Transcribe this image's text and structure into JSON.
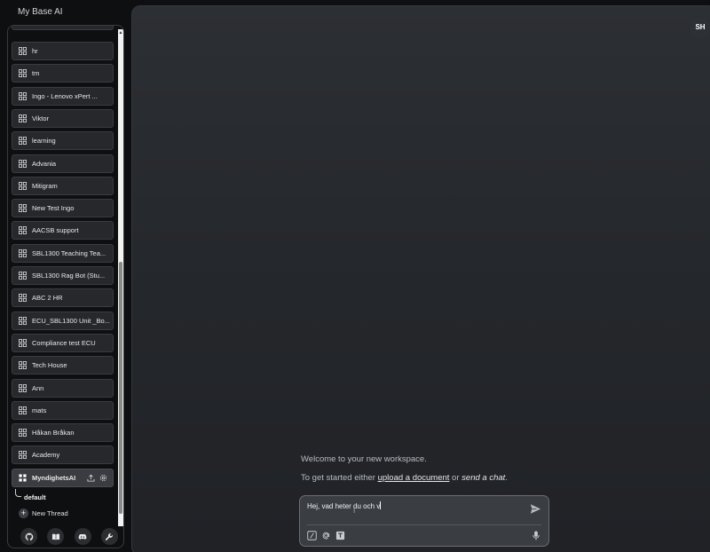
{
  "app": {
    "title": "My Base AI"
  },
  "sidebar": {
    "workspaces": [
      {
        "label": "hr"
      },
      {
        "label": "tm"
      },
      {
        "label": "Ingo - Lenovo xPert ..."
      },
      {
        "label": "Viktor"
      },
      {
        "label": "learning"
      },
      {
        "label": "Advania"
      },
      {
        "label": "Mitigram"
      },
      {
        "label": "New Test Ingo"
      },
      {
        "label": "AACSB support"
      },
      {
        "label": "SBL1300 Teaching Tea..."
      },
      {
        "label": "SBL1300 Rag Bot (Stu..."
      },
      {
        "label": "ABC 2 HR"
      },
      {
        "label": "ECU_SBL1300 Unit _Bo..."
      },
      {
        "label": "Compliance test ECU"
      },
      {
        "label": "Tech House"
      },
      {
        "label": "Ann"
      },
      {
        "label": "mats"
      },
      {
        "label": "Håkan Bråkan"
      },
      {
        "label": "Academy"
      }
    ],
    "active_workspace": {
      "label": "MyndighetsAI"
    },
    "thread": {
      "label": "default"
    },
    "new_thread_label": "New Thread",
    "footer_icons": [
      "github-icon",
      "book-icon",
      "discord-icon",
      "wrench-icon"
    ]
  },
  "main": {
    "avatar_initials": "SH",
    "welcome_text": "Welcome to your new workspace.",
    "get_started_prefix": "To get started either ",
    "upload_link": "upload a document",
    "or_text": " or ",
    "send_chat": "send a chat",
    "period": ".",
    "composer": {
      "value": "Hej, vad heter du och v",
      "tools": [
        "slash-command-icon",
        "at-mention-icon",
        "text-size-icon"
      ]
    }
  },
  "colors": {
    "background": "#0e0f11",
    "panel": "#26282c",
    "accent_text": "#e6e6e6"
  }
}
